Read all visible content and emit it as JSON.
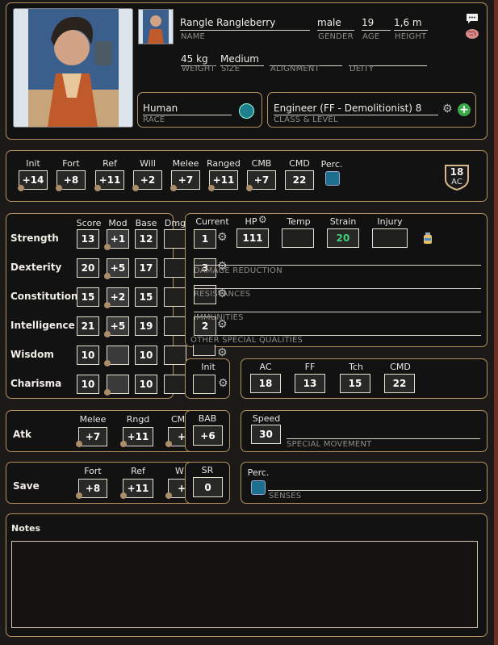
{
  "character": {
    "name": "Rangle Rangleberry",
    "gender": "male",
    "age": "19",
    "height": "1,6 m",
    "weight": "45 kg",
    "size": "Medium",
    "alignment": "",
    "deity": "",
    "race": "Human",
    "class_level": "Engineer (FF - Demolitionist) 8"
  },
  "labels": {
    "name": "NAME",
    "gender": "GENDER",
    "age": "AGE",
    "height": "HEIGHT",
    "weight": "WEIGHT",
    "size": "SIZE",
    "alignment": "ALIGNMENT",
    "deity": "DEITY",
    "race": "RACE",
    "class_level": "CLASS & LEVEL"
  },
  "combat_bar": {
    "items": [
      {
        "label": "Init",
        "value": "+14"
      },
      {
        "label": "Fort",
        "value": "+8"
      },
      {
        "label": "Ref",
        "value": "+11"
      },
      {
        "label": "Will",
        "value": "+2"
      },
      {
        "label": "Melee",
        "value": "+7"
      },
      {
        "label": "Ranged",
        "value": "+11"
      },
      {
        "label": "CMB",
        "value": "+7"
      },
      {
        "label": "CMD",
        "value": "22"
      }
    ],
    "perc_label": "Perc.",
    "ac_value": "18",
    "ac_label": "AC"
  },
  "abilities": {
    "headers": {
      "score": "Score",
      "mod": "Mod",
      "base": "Base",
      "dmg": "Dmg"
    },
    "rows": [
      {
        "name": "Strength",
        "score": "13",
        "mod": "+1",
        "base": "12"
      },
      {
        "name": "Dexterity",
        "score": "20",
        "mod": "+5",
        "base": "17"
      },
      {
        "name": "Constitution",
        "score": "15",
        "mod": "+2",
        "base": "15"
      },
      {
        "name": "Intelligence",
        "score": "21",
        "mod": "+5",
        "base": "19"
      },
      {
        "name": "Wisdom",
        "score": "10",
        "mod": "",
        "base": "10"
      },
      {
        "name": "Charisma",
        "score": "10",
        "mod": "",
        "base": "10"
      }
    ]
  },
  "hp": {
    "current_label": "Current",
    "hp_label": "HP",
    "temp_label": "Temp",
    "strain_label": "Strain",
    "injury_label": "Injury",
    "current": "1",
    "hp": "111",
    "temp": "",
    "strain": "20",
    "injury": "",
    "strain_color": "#3fcf7a",
    "damage_reduction_label": "DAMAGE REDUCTION",
    "damage_reduction_value": "3",
    "resistances_label": "RESISTANCES",
    "immunities_label": "IMMUNITIES",
    "immunities_value": "2",
    "other_label": "OTHER SPECIAL QUALITIES"
  },
  "init_box": {
    "label": "Init"
  },
  "defense": {
    "items": [
      {
        "label": "AC",
        "value": "18"
      },
      {
        "label": "FF",
        "value": "13"
      },
      {
        "label": "Tch",
        "value": "15"
      },
      {
        "label": "CMD",
        "value": "22"
      }
    ]
  },
  "attack": {
    "label": "Atk",
    "melee_label": "Melee",
    "melee": "+7",
    "rngd_label": "Rngd",
    "rngd": "+11",
    "cmb_label": "CM",
    "cmb": "+",
    "bab_label": "BAB",
    "bab": "+6"
  },
  "speed": {
    "label": "Speed",
    "value": "30",
    "special_label": "SPECIAL MOVEMENT"
  },
  "saves": {
    "label": "Save",
    "fort_label": "Fort",
    "fort": "+8",
    "ref_label": "Ref",
    "ref": "+11",
    "will_label": "W",
    "will": "+",
    "sr_label": "SR",
    "sr": "0"
  },
  "senses": {
    "perc_label": "Perc.",
    "label": "SENSES"
  },
  "notes": {
    "label": "Notes",
    "text": ""
  },
  "colors": {
    "accent_border": "#b49160",
    "add_button": "#3aa84a",
    "right_edge": "#6b2e1f"
  }
}
